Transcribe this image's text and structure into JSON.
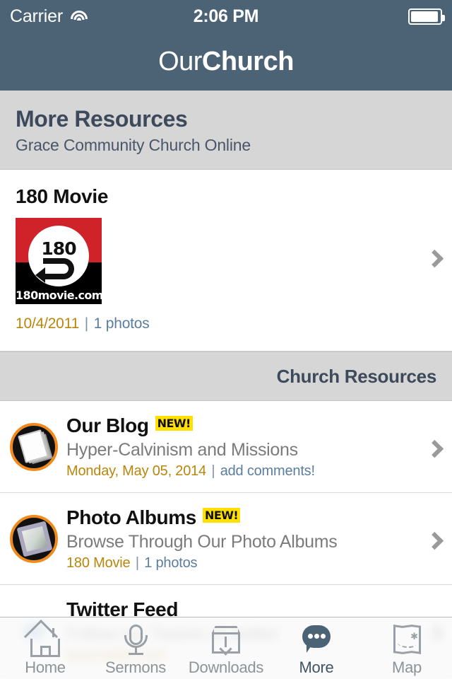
{
  "status_bar": {
    "carrier": "Carrier",
    "wifi_icon": "wifi-icon",
    "time": "2:06 PM",
    "battery_icon": "battery-icon"
  },
  "nav": {
    "brand_light": "Our",
    "brand_bold": "Church"
  },
  "page_head": {
    "title": "More Resources",
    "subtitle": "Grace Community Church Online"
  },
  "featured": {
    "title": "180 Movie",
    "thumbnail": {
      "number_text": "180",
      "caption": "180movie.com",
      "colors": {
        "red": "#cf2229",
        "black": "#000000"
      }
    },
    "meta_date": "10/4/2011",
    "meta_separator": "|",
    "meta_link": "1 photos",
    "chevron_icon": "chevron-right-icon"
  },
  "section": {
    "header": "Church Resources"
  },
  "rows": [
    {
      "icon": "blog-book-icon",
      "title": "Our Blog",
      "badge": "NEW!",
      "subtitle": "Hyper-Calvinism and Missions",
      "meta_date": "Monday, May 05, 2014",
      "meta_separator": "|",
      "meta_link": "add comments!",
      "chevron_icon": "chevron-right-icon"
    },
    {
      "icon": "photo-frame-icon",
      "title": "Photo Albums",
      "badge": "NEW!",
      "subtitle": "Browse Through Our Photo Albums",
      "meta_date": "180 Movie",
      "meta_separator": "|",
      "meta_link": "1 photos",
      "chevron_icon": "chevron-right-icon"
    },
    {
      "icon": "twitter-bird-icon",
      "title": "Twitter Feed",
      "badge": "",
      "subtitle": "Follow our Tweets on twitter",
      "meta_date": "www.twitter.com",
      "meta_separator": "|",
      "meta_link": "",
      "chevron_icon": "chevron-right-icon"
    }
  ],
  "tabbar": {
    "items": [
      {
        "icon": "home-icon",
        "label": "Home",
        "active": false
      },
      {
        "icon": "microphone-icon",
        "label": "Sermons",
        "active": false
      },
      {
        "icon": "download-icon",
        "label": "Downloads",
        "active": false
      },
      {
        "icon": "speech-bubble-icon",
        "label": "More",
        "active": true
      },
      {
        "icon": "map-icon",
        "label": "Map",
        "active": false
      }
    ]
  },
  "colors": {
    "header_bg": "#4c6275",
    "section_bg": "#d6d6d6",
    "badge_bg": "#ffe000",
    "meta_date": "#b8860b",
    "meta_link": "#5b7d9e",
    "icon_ring": "#f08a1c",
    "tab_inactive": "#8e9397",
    "tab_active": "#3f5467"
  }
}
